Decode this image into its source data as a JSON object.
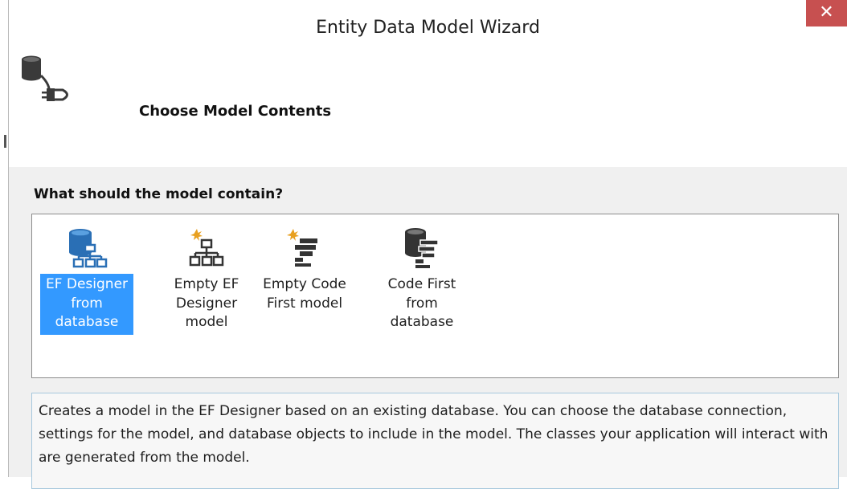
{
  "window": {
    "title": "Entity Data Model Wizard",
    "close_label": "✕"
  },
  "header": {
    "icon": "database-plug-icon",
    "title": "Choose Model Contents"
  },
  "question": "What should the model contain?",
  "choices": [
    {
      "label": "EF Designer from database",
      "icon": "ef-designer-database-icon",
      "selected": true
    },
    {
      "label": "Empty EF Designer model",
      "icon": "empty-ef-designer-icon",
      "selected": false
    },
    {
      "label": "Empty Code First model",
      "icon": "empty-code-first-icon",
      "selected": false
    },
    {
      "label": "Code First from database",
      "icon": "code-first-database-icon",
      "selected": false
    }
  ],
  "description": "Creates a model in the EF Designer based on an existing database. You can choose the database connection, settings for the model, and database objects to include in the model. The classes your application will interact with are generated from the model.",
  "colors": {
    "selection": "#3399ff",
    "close": "#c75050"
  }
}
